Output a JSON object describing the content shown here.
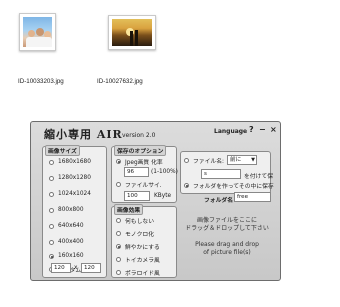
{
  "desktop": {
    "files": [
      {
        "name": "ID-10033203.jpg"
      },
      {
        "name": "ID-10027632.jpg"
      }
    ]
  },
  "app": {
    "title": "縮小専用 AIR",
    "version": "version 2.0",
    "language": "Language",
    "help": "?",
    "minimize": "−",
    "close": "×",
    "size_group": {
      "title": "画像サイズ",
      "options": [
        "1680x1680",
        "1280x1280",
        "1024x1024",
        "800x800",
        "640x640",
        "400x400",
        "160x160",
        "カスタム"
      ],
      "selected": "160x160",
      "custom_w": "120",
      "custom_x": "x",
      "custom_h": "120"
    },
    "save_group": {
      "title": "保存のオプション",
      "jpeg_label": "Jpeg画質 化率",
      "jpeg_value": "96",
      "jpeg_suffix": "(1-100%)",
      "filesize_label": "ファイルサイ.",
      "filesize_value": "100",
      "filesize_unit": "KByte"
    },
    "effect_group": {
      "title": "画像効果",
      "options": [
        "何もしない",
        "モノクロ化",
        "鮮やかにする",
        "トイカメラ風",
        "ポラロイド風"
      ],
      "selected": "鮮やかにする"
    },
    "name_group": {
      "filename_label": "ファイル名:",
      "filename_select": "前に",
      "prefix_value": "s",
      "prefix_suffix": "を付けて保",
      "folder_option": "フォルダを作ってその中に保存",
      "folder_label": "フォルダ名",
      "folder_value": "free"
    },
    "drop": {
      "jp_line1": "画像ファイルをここに",
      "jp_line2": "ドラッグ＆ドロップして下さい",
      "en_line1": "Please drag and drop",
      "en_line2": "of picture file(s)"
    }
  }
}
